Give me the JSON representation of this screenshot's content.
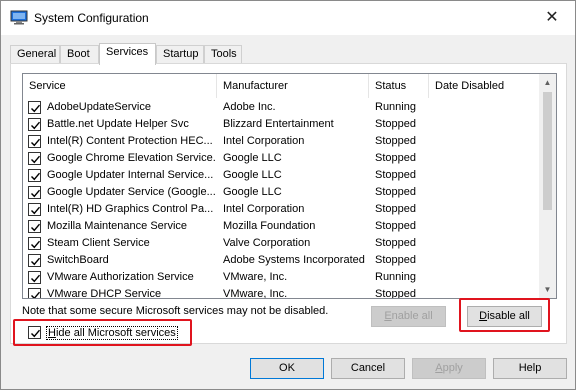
{
  "window": {
    "title": "System Configuration",
    "close_glyph": "✕"
  },
  "tabs": [
    {
      "label": "General"
    },
    {
      "label": "Boot"
    },
    {
      "label": "Services"
    },
    {
      "label": "Startup"
    },
    {
      "label": "Tools"
    }
  ],
  "services": {
    "columns": [
      "Service",
      "Manufacturer",
      "Status",
      "Date Disabled"
    ],
    "rows": [
      {
        "service": "AdobeUpdateService",
        "manufacturer": "Adobe Inc.",
        "status": "Running",
        "checked": true
      },
      {
        "service": "Battle.net Update Helper Svc",
        "manufacturer": "Blizzard Entertainment",
        "status": "Stopped",
        "checked": true
      },
      {
        "service": "Intel(R) Content Protection HEC...",
        "manufacturer": "Intel Corporation",
        "status": "Stopped",
        "checked": true
      },
      {
        "service": "Google Chrome Elevation Service...",
        "manufacturer": "Google LLC",
        "status": "Stopped",
        "checked": true
      },
      {
        "service": "Google Updater Internal Service...",
        "manufacturer": "Google LLC",
        "status": "Stopped",
        "checked": true
      },
      {
        "service": "Google Updater Service (Google...",
        "manufacturer": "Google LLC",
        "status": "Stopped",
        "checked": true
      },
      {
        "service": "Intel(R) HD Graphics Control Pa...",
        "manufacturer": "Intel Corporation",
        "status": "Stopped",
        "checked": true
      },
      {
        "service": "Mozilla Maintenance Service",
        "manufacturer": "Mozilla Foundation",
        "status": "Stopped",
        "checked": true
      },
      {
        "service": "Steam Client Service",
        "manufacturer": "Valve Corporation",
        "status": "Stopped",
        "checked": true
      },
      {
        "service": "SwitchBoard",
        "manufacturer": "Adobe Systems Incorporated",
        "status": "Stopped",
        "checked": true
      },
      {
        "service": "VMware Authorization Service",
        "manufacturer": "VMware, Inc.",
        "status": "Running",
        "checked": true
      },
      {
        "service": "VMware DHCP Service",
        "manufacturer": "VMware, Inc.",
        "status": "Stopped",
        "checked": true
      }
    ]
  },
  "note": "Note that some secure Microsoft services may not be disabled.",
  "enable_all": {
    "accel": "E",
    "rest": "nable all"
  },
  "disable_all": {
    "accel": "D",
    "rest": "isable all"
  },
  "hide_ms": {
    "accel": "H",
    "rest": "ide all Microsoft services",
    "checked": true
  },
  "buttons": {
    "ok": "OK",
    "cancel": "Cancel",
    "apply": {
      "accel": "A",
      "rest": "pply"
    },
    "help": "Help"
  },
  "colors": {
    "highlight": "#e0141e",
    "focus": "#0078d7"
  }
}
